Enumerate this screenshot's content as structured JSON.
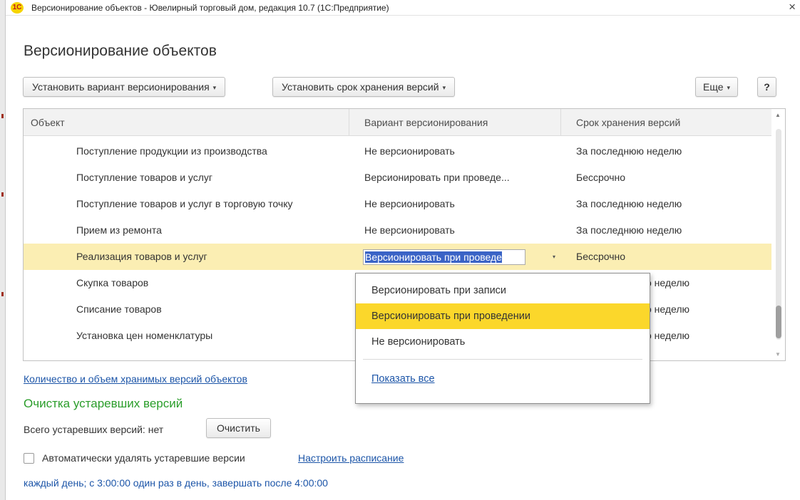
{
  "window": {
    "app_icon": "1С",
    "title": "Версионирование объектов - Ювелирный торговый дом, редакция 10.7  (1С:Предприятие)",
    "close_glyph": "×"
  },
  "form": {
    "title": "Версионирование объектов"
  },
  "toolbar": {
    "set_variant_label": "Установить вариант версионирования",
    "set_retention_label": "Установить срок хранения версий",
    "more_label": "Еще",
    "help_label": "?",
    "dropdown_glyph": "▾"
  },
  "grid": {
    "columns": [
      "Объект",
      "Вариант версионирования",
      "Срок хранения версий"
    ],
    "rows": [
      {
        "object": "Поступление продукции из производства",
        "variant": "Не версионировать",
        "retention": "За последнюю неделю"
      },
      {
        "object": "Поступление товаров и услуг",
        "variant": "Версионировать при проведе...",
        "retention": "Бессрочно"
      },
      {
        "object": "Поступление товаров и услуг в торговую точку",
        "variant": "Не версионировать",
        "retention": "За последнюю неделю"
      },
      {
        "object": "Прием из ремонта",
        "variant": "Не версионировать",
        "retention": "За последнюю неделю"
      },
      {
        "object": "Реализация товаров и услуг",
        "variant": "Версионировать при проведе",
        "retention": "Бессрочно"
      },
      {
        "object": "Скупка товаров",
        "variant": "",
        "retention": "о неделю"
      },
      {
        "object": "Списание товаров",
        "variant": "",
        "retention": "о неделю"
      },
      {
        "object": "Установка цен номенклатуры",
        "variant": "",
        "retention": "о неделю"
      }
    ],
    "selected_row_index": 4,
    "scroll_up_glyph": "▲",
    "scroll_down_glyph": "▼"
  },
  "dropdown_popup": {
    "options": [
      "Версионировать при записи",
      "Версионировать при проведении",
      "Не версионировать"
    ],
    "highlighted_index": 1,
    "show_all_label": "Показать все"
  },
  "footer": {
    "stats_link": "Количество и объем хранимых версий объектов",
    "cleanup_header": "Очистка устаревших версий",
    "obsolete_count_text": "Всего устаревших версий: нет",
    "clear_button": "Очистить",
    "auto_delete_label": "Автоматически удалять устаревшие версии",
    "auto_delete_checked": false,
    "schedule_link": "Настроить расписание",
    "schedule_text": "каждый день; с 3:00:00 один раз в день, завершать после 4:00:00"
  },
  "colors": {
    "selected_row": "#fbeeb3",
    "highlight_option": "#fbd72b",
    "link": "#1c55a8",
    "section_header": "#2a9d2a",
    "edit_selection": "#3a63c6"
  }
}
